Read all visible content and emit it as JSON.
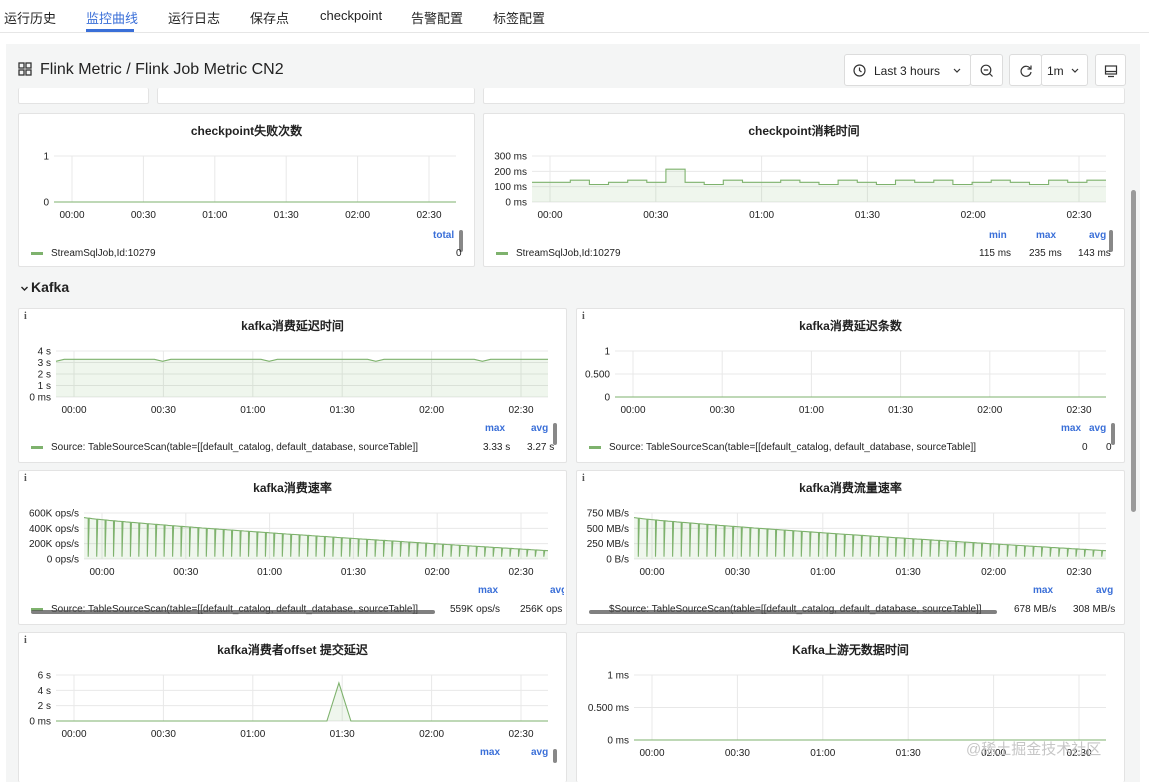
{
  "tabs": [
    "运行历史",
    "监控曲线",
    "运行日志",
    "保存点",
    "checkpoint",
    "告警配置",
    "标签配置"
  ],
  "active_tab": "监控曲线",
  "breadcrumb": "Flink Metric  / Flink Job Metric CN2",
  "time_range": "Last 3 hours",
  "refresh_interval": "1m",
  "section_kafka": "Kafka",
  "info_glyph": "i",
  "watermark": "@稀土掘金技术社区",
  "colors": {
    "accent": "#3a6fd8",
    "series": "#7eb26d",
    "grid": "#e8e8e8"
  },
  "x_ticks": [
    "00:00",
    "00:30",
    "01:00",
    "01:30",
    "02:00",
    "02:30"
  ],
  "panels": {
    "cp_fail": {
      "title": "checkpoint失败次数",
      "y_ticks": [
        "1",
        "0"
      ],
      "legend_headers": [
        "total"
      ],
      "legend_label": "StreamSqlJob,Id:10279",
      "legend_values": [
        "0"
      ]
    },
    "cp_time": {
      "title": "checkpoint消耗时间",
      "y_ticks": [
        "300 ms",
        "200 ms",
        "100 ms",
        "0 ms"
      ],
      "legend_headers": [
        "min",
        "max",
        "avg"
      ],
      "legend_label": "StreamSqlJob,Id:10279",
      "legend_values": [
        "115 ms",
        "235 ms",
        "143 ms"
      ]
    },
    "k_lag_time": {
      "title": "kafka消费延迟时间",
      "y_ticks": [
        "4 s",
        "3 s",
        "2 s",
        "1 s",
        "0 ms"
      ],
      "legend_headers": [
        "max",
        "avg"
      ],
      "legend_label": "Source: TableSourceScan(table=[[default_catalog, default_database, sourceTable]]",
      "legend_values": [
        "3.33 s",
        "3.27 s"
      ]
    },
    "k_lag_count": {
      "title": "kafka消费延迟条数",
      "y_ticks": [
        "1",
        "0.500",
        "0"
      ],
      "legend_headers": [
        "max",
        "avg"
      ],
      "legend_label": "Source: TableSourceScan(table=[[default_catalog, default_database, sourceTable]]",
      "legend_values": [
        "0",
        "0"
      ]
    },
    "k_rate": {
      "title": "kafka消费速率",
      "y_ticks": [
        "600K ops/s",
        "400K ops/s",
        "200K ops/s",
        "0 ops/s"
      ],
      "legend_headers": [
        "max",
        "avg"
      ],
      "legend_label": "Source: TableSourceScan(table=[[default_catalog, default_database, sourceTable]]",
      "legend_values": [
        "559K ops/s",
        "256K ops"
      ]
    },
    "k_bytes": {
      "title": "kafka消费流量速率",
      "y_ticks": [
        "750 MB/s",
        "500 MB/s",
        "250 MB/s",
        "0 B/s"
      ],
      "legend_headers": [
        "max",
        "avg"
      ],
      "legend_label": "$Source: TableSourceScan(table=[[default_catalog, default_database, sourceTable]]",
      "legend_values": [
        "678 MB/s",
        "308 MB/s"
      ]
    },
    "k_offset": {
      "title": "kafka消费者offset 提交延迟",
      "y_ticks": [
        "6 s",
        "4 s",
        "2 s",
        "0 ms"
      ],
      "legend_headers": [
        "max",
        "avg"
      ]
    },
    "k_nodata": {
      "title": "Kafka上游无数据时间",
      "y_ticks": [
        "1 ms",
        "0.500 ms",
        "0 ms"
      ]
    }
  }
}
